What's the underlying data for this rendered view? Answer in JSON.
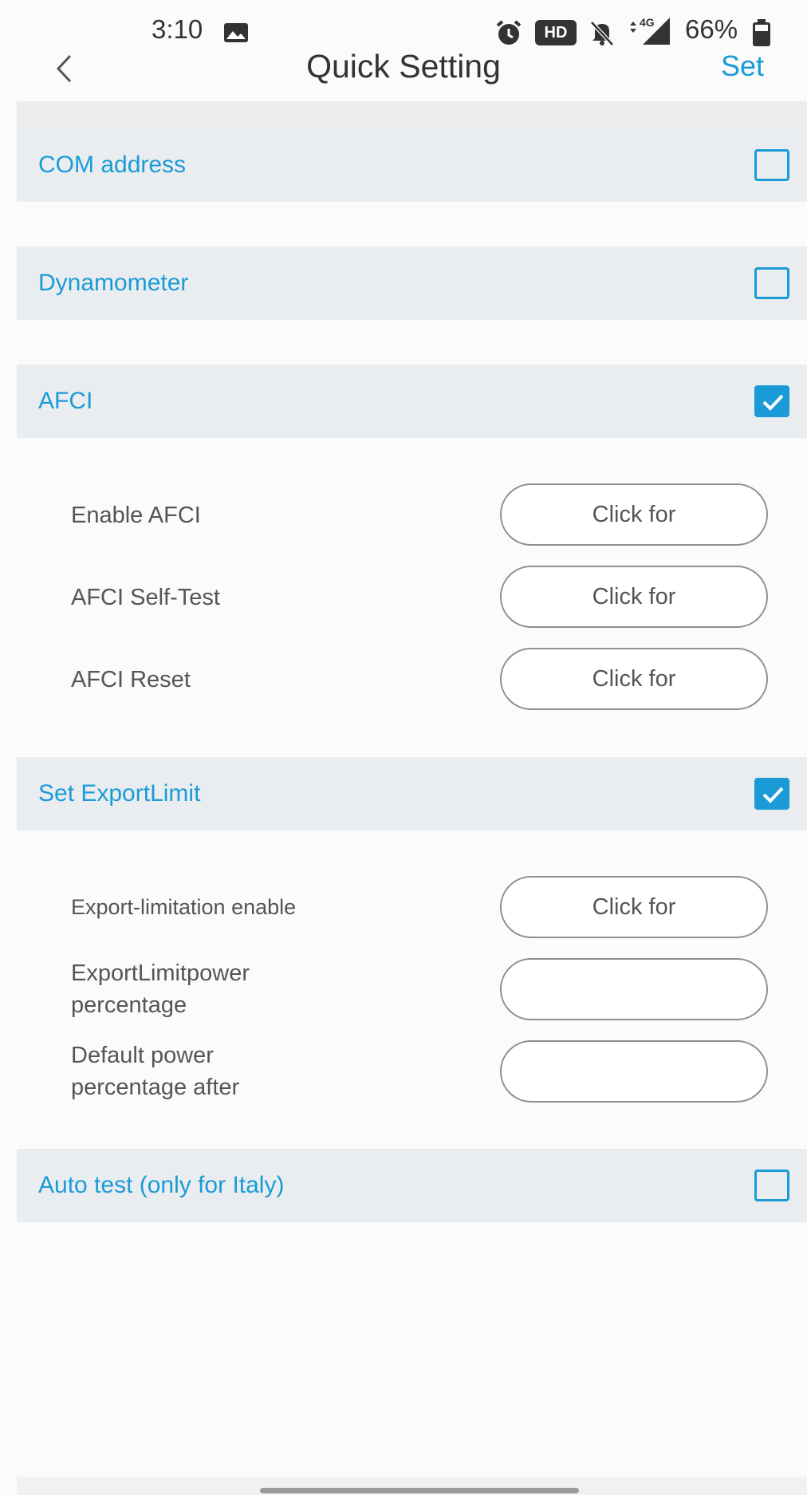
{
  "status_bar": {
    "time": "3:10",
    "hd_badge": "HD",
    "network": "4G",
    "battery_percent": "66%",
    "icons": [
      "image-icon",
      "alarm-icon",
      "hd-icon",
      "mute-icon",
      "signal-icon",
      "battery-icon"
    ]
  },
  "header": {
    "title": "Quick Setting",
    "set_label": "Set",
    "back_icon": "chevron-left-icon"
  },
  "sections": {
    "com_address": {
      "label": "COM address",
      "checked": false
    },
    "dynamometer": {
      "label": "Dynamometer",
      "checked": false
    },
    "afci": {
      "label": "AFCI",
      "checked": true,
      "rows": [
        {
          "label": "Enable AFCI",
          "button": "Click for"
        },
        {
          "label": "AFCI Self-Test",
          "button": "Click for"
        },
        {
          "label": "AFCI Reset",
          "button": "Click for"
        }
      ]
    },
    "export_limit": {
      "label": "Set ExportLimit",
      "checked": true,
      "rows": [
        {
          "label": "Export-limitation enable",
          "button": "Click for"
        },
        {
          "label_line1": "ExportLimitpower",
          "label_line2": "percentage",
          "value": ""
        },
        {
          "label_line1": "Default power",
          "label_line2": "percentage after",
          "value": ""
        }
      ]
    },
    "auto_test": {
      "label": "Auto test (only for Italy)",
      "checked": false
    }
  },
  "colors": {
    "accent": "#1a9bd7",
    "section_bg": "#eaedf0",
    "text": "#555555",
    "page_bg": "#fbfbfb"
  }
}
